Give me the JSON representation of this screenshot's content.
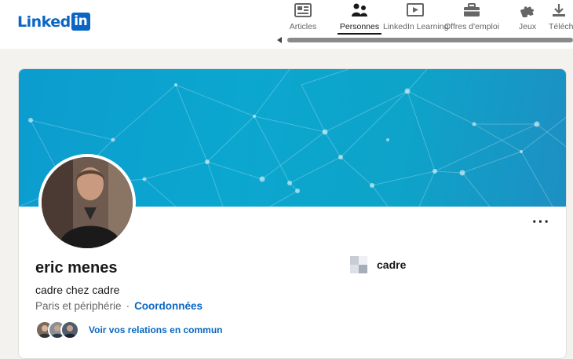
{
  "brand": {
    "logo_text": "Linked",
    "logo_box_text": "in",
    "color": "#0a66c2"
  },
  "nav": {
    "items": [
      {
        "label": "Articles",
        "icon": "article-icon",
        "active": false
      },
      {
        "label": "Personnes",
        "icon": "people-icon",
        "active": true
      },
      {
        "label": "LinkedIn Learning",
        "icon": "learning-play-icon",
        "active": false
      },
      {
        "label": "Offres d'emploi",
        "icon": "briefcase-icon",
        "active": false
      },
      {
        "label": "Jeux",
        "icon": "puzzle-icon",
        "active": false
      },
      {
        "label": "Téléch",
        "icon": "download-icon",
        "active": false
      }
    ]
  },
  "profile": {
    "name": "eric menes",
    "headline": "cadre chez cadre",
    "location": "Paris et périphérie",
    "separator": "·",
    "contact_link": "Coordonnées",
    "more_button": "···",
    "company": {
      "name": "cadre",
      "icon": "company-logo-icon"
    },
    "mutual_connections_text": "Voir vos relations en commun"
  },
  "colors": {
    "banner": "#0ba7cf",
    "link": "#0a66c2",
    "text": "#191919",
    "muted": "#666666"
  }
}
